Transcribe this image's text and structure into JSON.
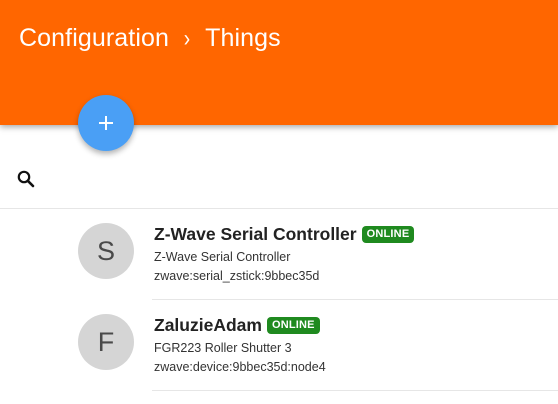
{
  "colors": {
    "header": "#ff6600",
    "fab": "#4a9ff5",
    "online_badge": "#1f8a1f",
    "avatar": "#d5d5d5"
  },
  "breadcrumb": {
    "parent": "Configuration",
    "separator_icon": "chevron-right-icon",
    "current": "Things"
  },
  "fab": {
    "icon": "plus-icon"
  },
  "search": {
    "icon": "search-icon",
    "value": "",
    "placeholder": ""
  },
  "things": [
    {
      "initial": "S",
      "name": "Z-Wave Serial Controller",
      "status": "ONLINE",
      "type": "Z-Wave Serial Controller",
      "uid": "zwave:serial_zstick:9bbec35d"
    },
    {
      "initial": "F",
      "name": "ZaluzieAdam",
      "status": "ONLINE",
      "type": "FGR223 Roller Shutter 3",
      "uid": "zwave:device:9bbec35d:node4"
    }
  ]
}
